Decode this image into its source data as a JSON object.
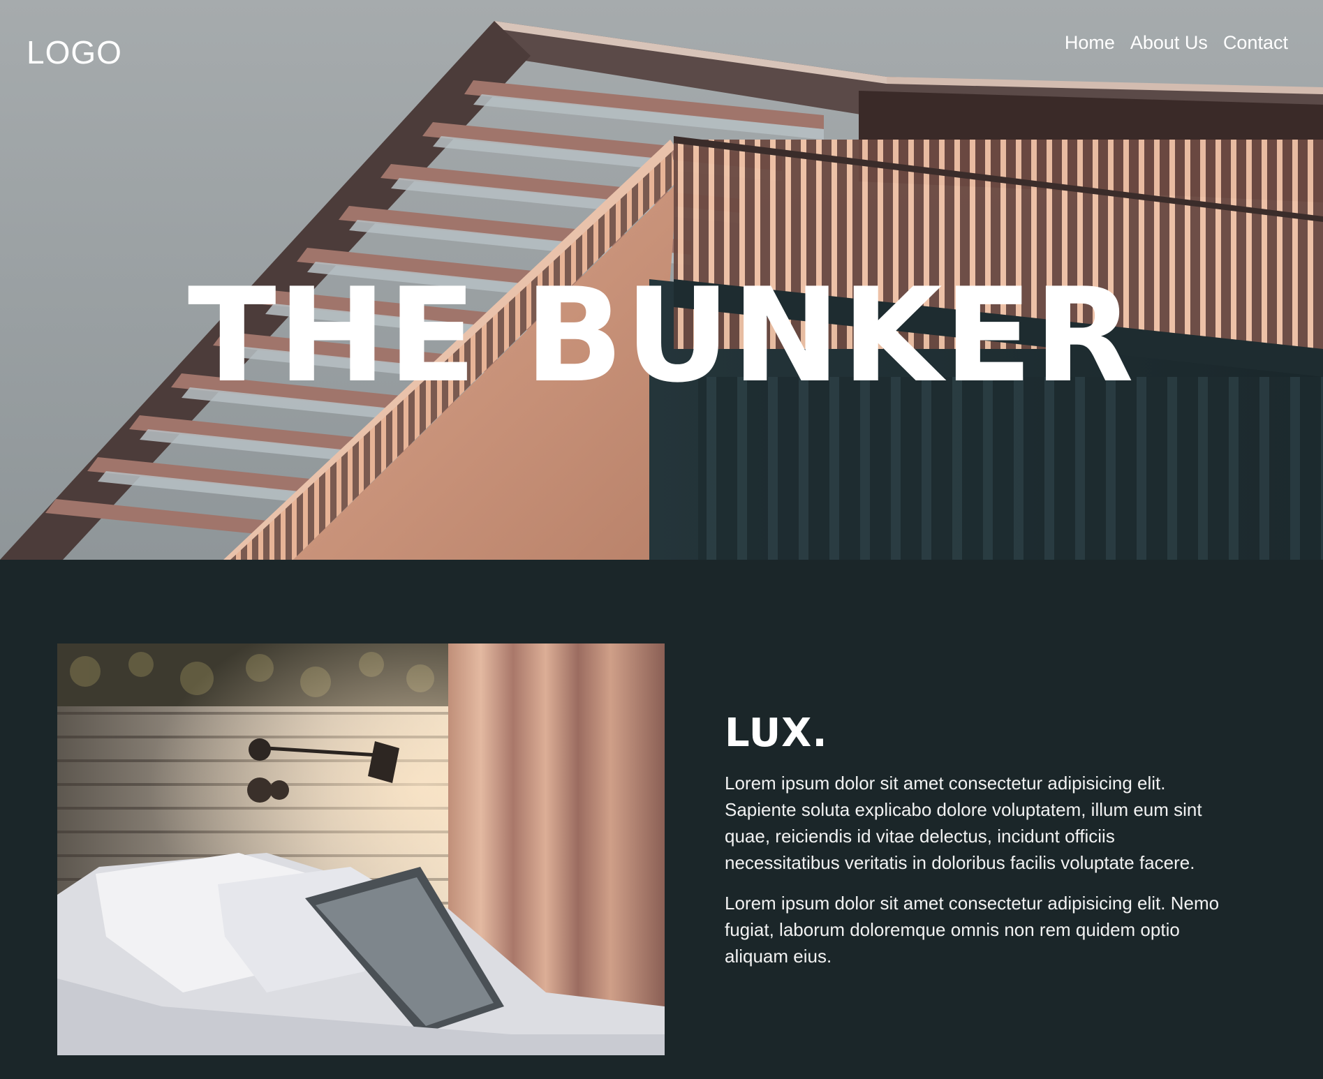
{
  "nav": {
    "logo": "LOGO",
    "links": [
      "Home",
      "About Us",
      "Contact"
    ]
  },
  "hero": {
    "title": "THE BUNKER",
    "image": "building-architecture-photo"
  },
  "feature": {
    "image": "bedroom-photo",
    "heading": "LUX.",
    "paragraphs": [
      "Lorem ipsum dolor sit amet consectetur adipisicing elit. Sapiente soluta explicabo dolore voluptatem, illum eum sint quae, reiciendis id vitae delectus, incidunt officiis necessitatibus veritatis in doloribus facilis voluptate facere.",
      "Lorem ipsum dolor sit amet consectetur adipisicing elit. Nemo fugiat, laborum doloremque omnis non rem quidem optio aliquam eius."
    ]
  },
  "colors": {
    "background": "#1b2629",
    "text": "#ffffff",
    "sky": "#9aa1a3",
    "wood": "#c9927a",
    "dark_facade": "#1f2d31"
  }
}
